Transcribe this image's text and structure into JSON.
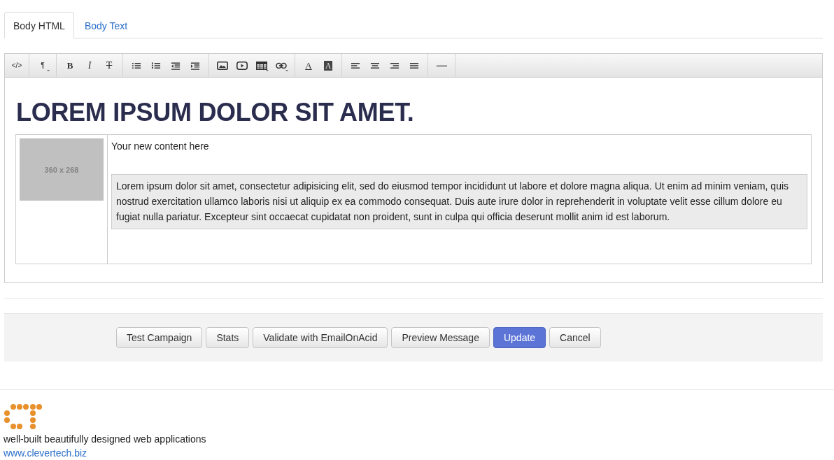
{
  "tabs": [
    {
      "label": "Body HTML",
      "selected": true
    },
    {
      "label": "Body Text",
      "selected": false
    }
  ],
  "toolbar": [
    [
      {
        "kind": "glyph",
        "text": "</>",
        "dropdown": false
      }
    ],
    [
      {
        "kind": "glyph",
        "text": "¶",
        "dropdown": true
      }
    ],
    [
      {
        "kind": "bold",
        "text": "B",
        "dropdown": false
      },
      {
        "kind": "italic",
        "text": "I",
        "dropdown": false
      },
      {
        "kind": "strike",
        "text": "T",
        "dropdown": false
      }
    ],
    [
      {
        "kind": "bullets",
        "dropdown": false
      },
      {
        "kind": "numbers",
        "dropdown": false
      },
      {
        "kind": "outdent",
        "dropdown": false
      },
      {
        "kind": "indent",
        "dropdown": false
      }
    ],
    [
      {
        "kind": "image",
        "dropdown": false
      },
      {
        "kind": "video",
        "dropdown": false
      },
      {
        "kind": "table",
        "dropdown": true
      },
      {
        "kind": "link",
        "dropdown": true
      }
    ],
    [
      {
        "kind": "underline",
        "text": "A",
        "dropdown": false
      },
      {
        "kind": "inverse",
        "text": "A",
        "dropdown": false
      }
    ],
    [
      {
        "kind": "align-left",
        "dropdown": false
      },
      {
        "kind": "align-center",
        "dropdown": false
      },
      {
        "kind": "align-right",
        "dropdown": false
      },
      {
        "kind": "justify",
        "dropdown": false
      }
    ],
    [
      {
        "kind": "rule",
        "dropdown": false
      }
    ]
  ],
  "heading": "LOREM IPSUM DOLOR SIT AMET.",
  "image_placeholder": "360 x 268",
  "content_title": "Your new content here",
  "content_body": "Lorem ipsum dolor sit amet, consectetur adipisicing elit, sed do eiusmod tempor incididunt ut labore et dolore magna aliqua. Ut enim ad minim veniam, quis nostrud exercitation ullamco laboris nisi ut aliquip ex ea commodo consequat. Duis aute irure dolor in reprehenderit in voluptate velit esse cillum dolore eu fugiat nulla pariatur. Excepteur sint occaecat cupidatat non proident, sunt in culpa qui officia deserunt mollit anim id est laborum.",
  "actions": [
    {
      "label": "Test Campaign",
      "primary": false
    },
    {
      "label": "Stats",
      "primary": false
    },
    {
      "label": "Validate with EmailOnAcid",
      "primary": false
    },
    {
      "label": "Preview Message",
      "primary": false
    },
    {
      "label": "Update",
      "primary": true
    },
    {
      "label": "Cancel",
      "primary": false
    }
  ],
  "footer": {
    "tagline": "well-built beautifully designed web applications",
    "link": "www.clevertech.biz"
  }
}
